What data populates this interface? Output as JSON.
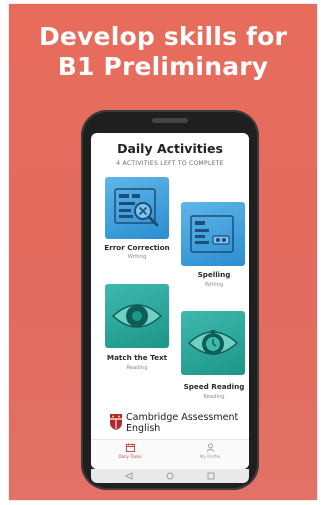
{
  "headline": {
    "line1": "Develop skills for",
    "line2": "B1 Preliminary"
  },
  "screen": {
    "title": "Daily Activities",
    "subtitle": "4 ACTIVITIES LEFT TO COMPLETE",
    "activities": [
      {
        "name": "Error Correction",
        "category": "Writing",
        "color": "#3a9ddd",
        "icon": "magnifier-document-icon"
      },
      {
        "name": "Spelling",
        "category": "Writing",
        "color": "#3a9ddd",
        "icon": "book-letters-icon"
      },
      {
        "name": "Match the Text",
        "category": "Reading",
        "color": "#2aa89c",
        "icon": "eye-icon"
      },
      {
        "name": "Speed Reading",
        "category": "Reading",
        "color": "#2aa89c",
        "icon": "eye-stopwatch-icon"
      }
    ],
    "logo": {
      "line1": "Cambridge Assessment",
      "line2": "English",
      "icon": "shield-crest-icon"
    },
    "tabs": [
      {
        "label": "Daily Tasks",
        "icon": "calendar-icon",
        "active": true,
        "color": "#c0504d"
      },
      {
        "label": "My Profile",
        "icon": "person-icon",
        "active": false,
        "color": "#9a9a9a"
      }
    ],
    "nav_buttons": [
      "back-icon",
      "home-icon",
      "recents-icon"
    ]
  },
  "colors": {
    "background": "#e46d5f",
    "blue_tile": "#3a9ddd",
    "teal_tile": "#2aa89c",
    "active_tab": "#c0504d"
  }
}
